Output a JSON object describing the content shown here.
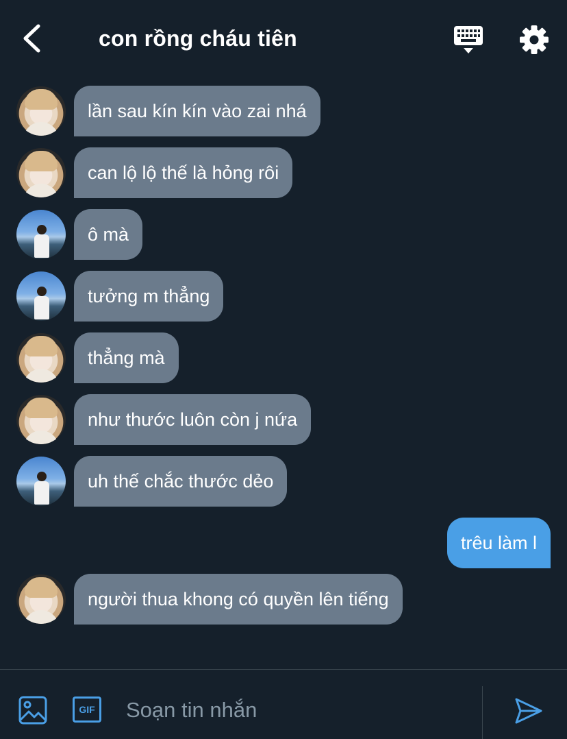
{
  "header": {
    "title": "con rồng cháu tiên",
    "back_icon": "chevron-left-icon",
    "keyboard_icon": "keyboard-icon",
    "settings_icon": "gear-icon"
  },
  "messages": [
    {
      "sender": "contact_a",
      "direction": "incoming",
      "text": "lần sau kín kín vào zai nhá"
    },
    {
      "sender": "contact_a",
      "direction": "incoming",
      "text": "can lộ lộ thế là hỏng rôi"
    },
    {
      "sender": "contact_b",
      "direction": "incoming",
      "text": "ô mà"
    },
    {
      "sender": "contact_b",
      "direction": "incoming",
      "text": "tưởng m thẳng"
    },
    {
      "sender": "contact_a",
      "direction": "incoming",
      "text": "thẳng mà"
    },
    {
      "sender": "contact_a",
      "direction": "incoming",
      "text": "như thước luôn còn j nứa"
    },
    {
      "sender": "contact_b",
      "direction": "incoming",
      "text": "uh thế chắc thước dẻo"
    },
    {
      "sender": "me",
      "direction": "outgoing",
      "text": "trêu làm l"
    },
    {
      "sender": "contact_a",
      "direction": "incoming",
      "text": "người thua khong có quyền lên tiếng"
    }
  ],
  "composer": {
    "placeholder": "Soạn tin nhắn",
    "value": "",
    "image_icon": "image-icon",
    "gif_label": "GIF",
    "send_icon": "send-icon"
  },
  "colors": {
    "background": "#15202b",
    "incoming_bubble": "#6b7b8c",
    "outgoing_bubble": "#4a9fe6",
    "accent": "#4a9fe6",
    "placeholder": "#8899a6"
  }
}
